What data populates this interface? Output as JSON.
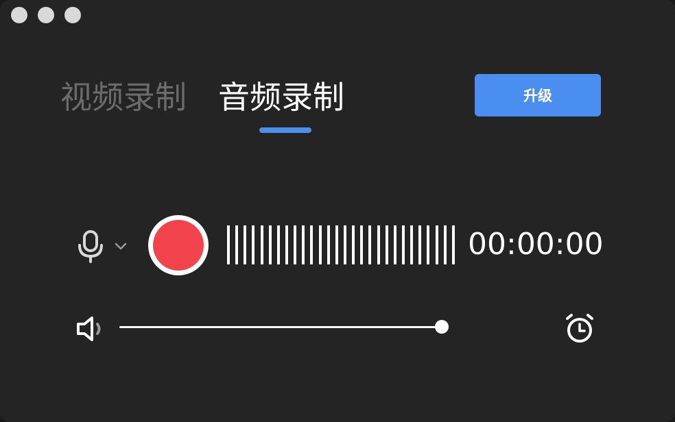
{
  "tabs": [
    {
      "label": "视频录制",
      "active": false
    },
    {
      "label": "音频录制",
      "active": true
    }
  ],
  "upgrade_button": {
    "label": "升级"
  },
  "recorder": {
    "timer": "00:00:00",
    "volume_level": 1.0,
    "waveform_bar_count": 28
  },
  "icons": {
    "microphone": "microphone-icon",
    "mic_dropdown": "chevron-down-icon",
    "record": "record-icon",
    "volume": "speaker-icon",
    "schedule": "alarm-clock-icon"
  },
  "colors": {
    "background": "#242425",
    "accent": "#4a8ff0",
    "record": "#f2434d",
    "inactive_tab": "#6b6b6b"
  }
}
